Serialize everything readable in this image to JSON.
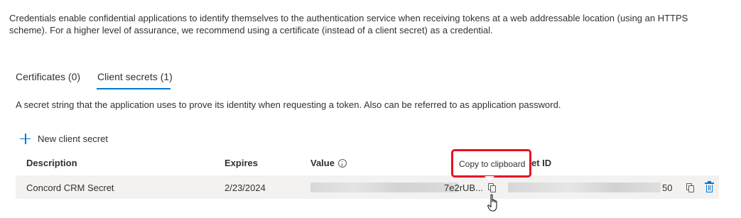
{
  "intro_text": "Credentials enable confidential applications to identify themselves to the authentication service when receiving tokens at a web addressable location (using an HTTPS scheme). For a higher level of assurance, we recommend using a certificate (instead of a client secret) as a credential.",
  "tabs": [
    {
      "label": "Certificates (0)",
      "selected": false
    },
    {
      "label": "Client secrets (1)",
      "selected": true
    }
  ],
  "section_description": "A secret string that the application uses to prove its identity when requesting a token. Also can be referred to as application password.",
  "new_secret_label": "New client secret",
  "columns": {
    "description": "Description",
    "expires": "Expires",
    "value": "Value",
    "secret_id_partial": "et ID"
  },
  "rows": [
    {
      "description": "Concord CRM Secret",
      "expires": "2/23/2024",
      "value_tail": "7e2rUB...",
      "secret_id_tail": "50"
    }
  ],
  "tooltip": "Copy to clipboard",
  "icons": {
    "add": "plus-icon",
    "info": "info-icon",
    "copy": "copy-icon",
    "delete": "trash-icon",
    "cursor": "pointer-hand-cursor"
  },
  "colors": {
    "accent": "#0078d4",
    "highlight_box": "#e81123",
    "row_bg": "#f3f2f1"
  }
}
